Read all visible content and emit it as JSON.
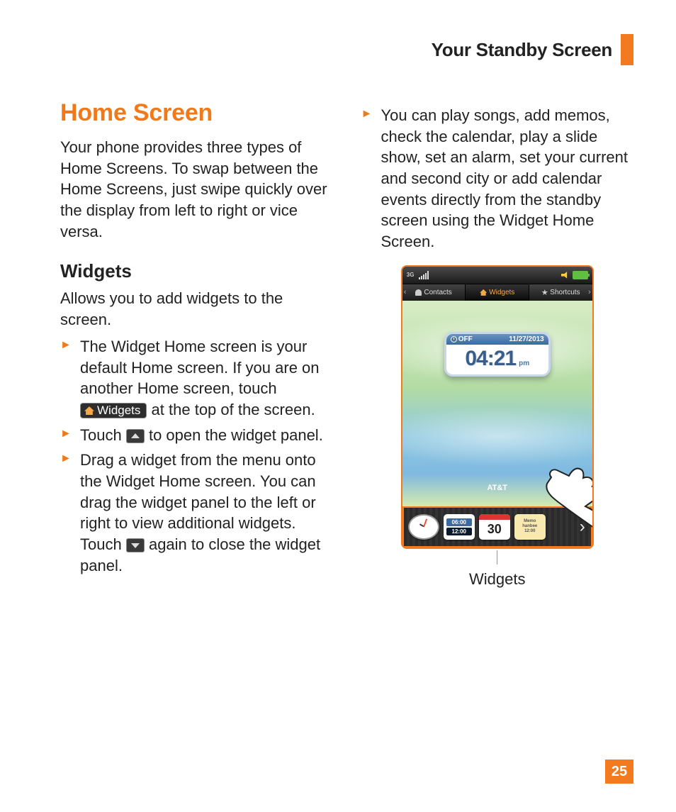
{
  "header": {
    "title": "Your Standby Screen"
  },
  "section": {
    "title": "Home Screen"
  },
  "intro": "Your phone provides three types of Home Screens. To swap between the Home Screens, just swipe quickly over the display from left to right or vice versa.",
  "widgets": {
    "heading": "Widgets",
    "subtitle": "Allows you to add widgets to the screen.",
    "bullets": {
      "b1_pre": "The Widget Home screen is your default Home screen. If you are on another Home screen, touch ",
      "b1_chip": "Widgets",
      "b1_post": " at the top of the screen.",
      "b2_pre": "Touch ",
      "b2_post": " to open the widget panel.",
      "b3_pre": "Drag a widget from the menu onto the Widget Home screen. You can drag the widget panel to the left or right to view additional widgets. Touch ",
      "b3_post": " again to close the widget panel."
    }
  },
  "right_bullet": "You can play songs, add memos, check the calendar, play a slide show, set an alarm, set your current and second city or add calendar events directly from the standby screen using the Widget Home Screen.",
  "phone": {
    "network": "3G",
    "tabs": {
      "contacts": "Contacts",
      "widgets": "Widgets",
      "shortcuts": "Shortcuts"
    },
    "clock": {
      "alarm": "OFF",
      "date": "11/27/2013",
      "time": "04:21",
      "ampm": "pm"
    },
    "carrier": "AT&T",
    "tray": {
      "dual_top": "06:00",
      "dual_bottom": "12:00",
      "calendar_day": "30",
      "memo_l1": "Memo",
      "memo_l2": "hanbee",
      "memo_l3": "12:00"
    }
  },
  "callout": "Widgets",
  "page_number": "25"
}
